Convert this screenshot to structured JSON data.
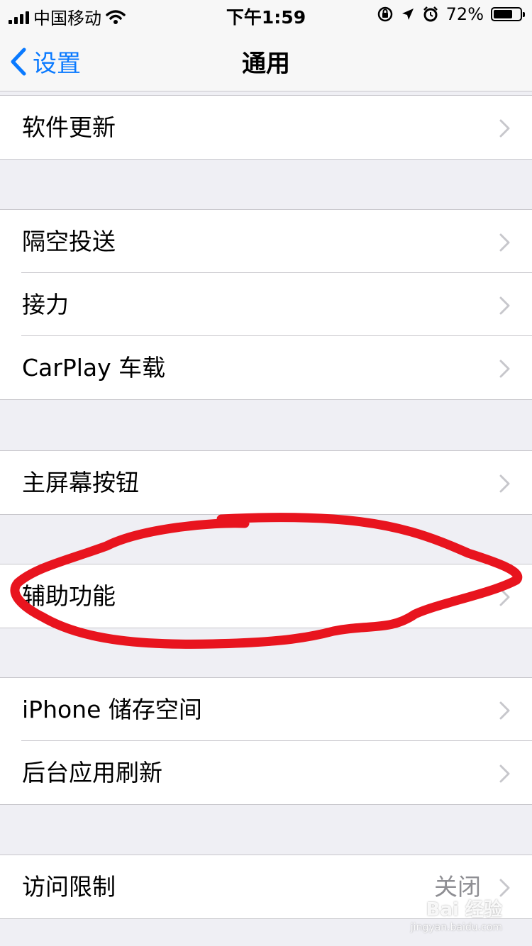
{
  "status_bar": {
    "carrier": "中国移动",
    "time": "下午1:59",
    "battery_percent": "72%",
    "battery_level": 0.72,
    "icons": [
      "signal-icon",
      "wifi-icon",
      "rotation-lock-icon",
      "location-icon",
      "alarm-icon",
      "battery-icon"
    ]
  },
  "nav": {
    "back_label": "设置",
    "title": "通用"
  },
  "groups": [
    {
      "rows": [
        {
          "label": "软件更新"
        }
      ]
    },
    {
      "rows": [
        {
          "label": "隔空投送"
        },
        {
          "label": "接力"
        },
        {
          "label": "CarPlay 车载"
        }
      ]
    },
    {
      "rows": [
        {
          "label": "主屏幕按钮"
        }
      ]
    },
    {
      "rows": [
        {
          "label": "辅助功能"
        }
      ]
    },
    {
      "rows": [
        {
          "label": "iPhone 储存空间"
        },
        {
          "label": "后台应用刷新"
        }
      ]
    },
    {
      "rows": [
        {
          "label": "访问限制",
          "value": "关闭"
        }
      ]
    }
  ],
  "watermark": {
    "text": "Bai 经验",
    "sub": "jingyan.baidu.com"
  },
  "colors": {
    "accent": "#0a7aff",
    "annotation": "#e8141e",
    "separator": "#c8c7cc",
    "background": "#efeff4"
  }
}
